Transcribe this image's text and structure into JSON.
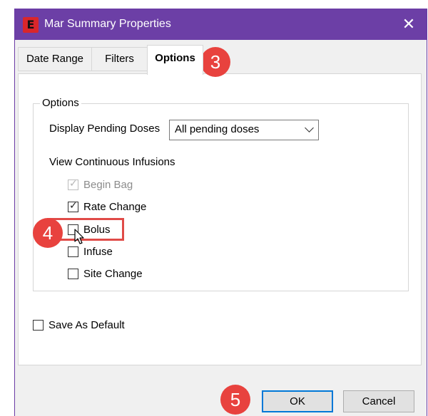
{
  "window": {
    "title": "Mar Summary Properties",
    "logo_letter": "E",
    "close_glyph": "✕",
    "accent_color": "#6c3fa6"
  },
  "tabs": [
    {
      "label": "Date Range",
      "active": false
    },
    {
      "label": "Filters",
      "active": false
    },
    {
      "label": "Options",
      "active": true
    }
  ],
  "options_group": {
    "legend": "Options",
    "pending_doses_label": "Display Pending Doses",
    "pending_doses_value": "All pending doses",
    "infusions_label": "View Continuous Infusions",
    "checkboxes": [
      {
        "label": "Begin Bag",
        "checked": true,
        "disabled": true
      },
      {
        "label": "Rate Change",
        "checked": true,
        "disabled": false
      },
      {
        "label": "Bolus",
        "checked": false,
        "disabled": false
      },
      {
        "label": "Infuse",
        "checked": false,
        "disabled": false
      },
      {
        "label": "Site Change",
        "checked": false,
        "disabled": false
      }
    ]
  },
  "save_default": {
    "label": "Save As Default",
    "checked": false
  },
  "buttons": {
    "ok": "OK",
    "cancel": "Cancel"
  },
  "callouts": {
    "step3": "3",
    "step4": "4",
    "step5": "5",
    "color": "#e8423e"
  }
}
